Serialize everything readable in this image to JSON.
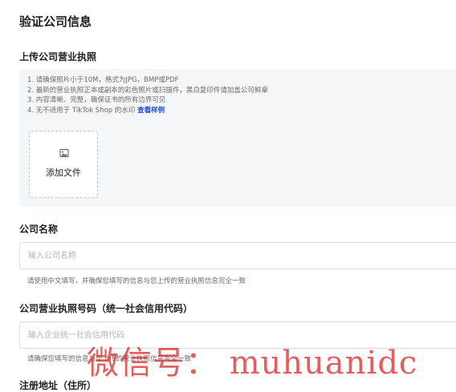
{
  "page": {
    "title": "验证公司信息"
  },
  "license_upload": {
    "label": "上传公司营业执照",
    "requirements": [
      "1. 请确保照片小于10M，格式为JPG，BMP或PDF",
      "2. 最新的营业执照正本或副本的彩色照片或扫描件，黑白复印件请加盖公司鲜章",
      "3. 内容清晰、完整，确保证书的所有边界可见",
      "4. 无不适用于 TikTok Shop 的水印"
    ],
    "example_link": "查看样例",
    "add_file_label": "添加文件",
    "image_icon": "image-icon"
  },
  "company_name": {
    "label": "公司名称",
    "placeholder": "输入公司名称",
    "hint": "请使用中文填写，并确保您填写的信息与您上传的营业执照信息完全一致"
  },
  "license_number": {
    "label": "公司营业执照号码（统一社会信用代码）",
    "placeholder": "输入企业统一社会信用代码",
    "hint": "请确保您填写的信息与您上传的营业执照信息完全一致"
  },
  "address": {
    "label": "注册地址（住所）"
  },
  "watermark": "微信号： muhuanidc"
}
